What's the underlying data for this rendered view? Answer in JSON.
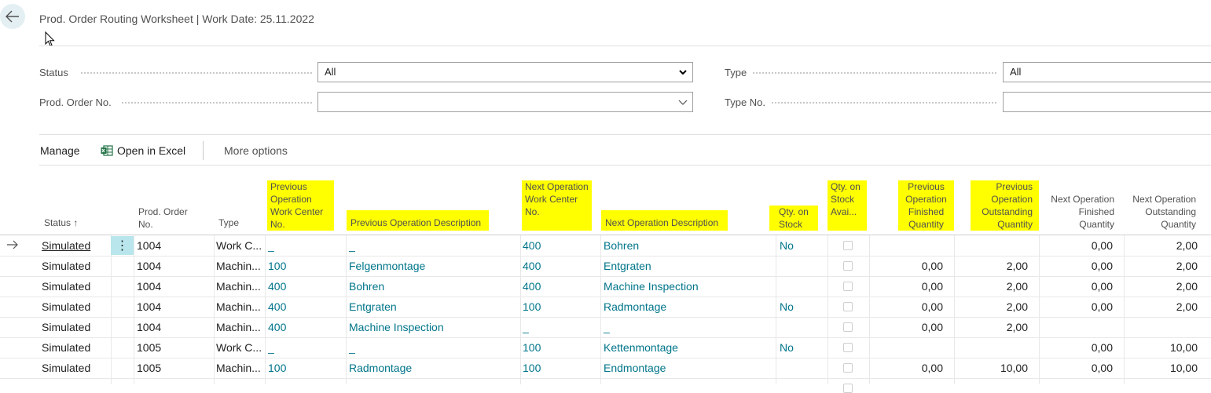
{
  "page": {
    "title": "Prod. Order Routing Worksheet | Work Date: 25.11.2022"
  },
  "filters": {
    "status_label": "Status",
    "status_value": "All",
    "prod_order_label": "Prod. Order No.",
    "prod_order_value": "",
    "type_label": "Type",
    "type_value": "All",
    "type_no_label": "Type No.",
    "type_no_value": ""
  },
  "actions": {
    "manage": "Manage",
    "open_in_excel": "Open in Excel",
    "more_options": "More options"
  },
  "columns": {
    "status": "Status ↑",
    "prod_order_no": "Prod. Order No.",
    "type": "Type",
    "prev_wc": "Previous Operation Work Center No.",
    "prev_desc": "Previous Operation Description",
    "next_wc": "Next Operation Work Center No.",
    "next_desc": "Next Operation Description",
    "qty_on_stock": "Qty. on Stock",
    "qty_on_stock_avail": "Qty. on Stock Avai...",
    "prev_finished": "Previous Operation Finished Quantity",
    "prev_outstanding": "Previous Operation Outstanding Quantity",
    "next_finished": "Next Operation Finished Quantity",
    "next_outstanding": "Next Operation Outstanding Quantity"
  },
  "rows": [
    {
      "status": "Simulated",
      "order": "1004",
      "type": "Work C...",
      "prev_wc": "_",
      "prev_desc": "_",
      "next_wc": "400",
      "next_desc": "Bohren",
      "stock": "No",
      "prev_fin": "",
      "prev_out": "",
      "next_fin": "0,00",
      "next_out": "2,00"
    },
    {
      "status": "Simulated",
      "order": "1004",
      "type": "Machin...",
      "prev_wc": "100",
      "prev_desc": "Felgenmontage",
      "next_wc": "400",
      "next_desc": "Entgraten",
      "stock": "",
      "prev_fin": "0,00",
      "prev_out": "2,00",
      "next_fin": "0,00",
      "next_out": "2,00"
    },
    {
      "status": "Simulated",
      "order": "1004",
      "type": "Machin...",
      "prev_wc": "400",
      "prev_desc": "Bohren",
      "next_wc": "400",
      "next_desc": "Machine Inspection",
      "stock": "",
      "prev_fin": "0,00",
      "prev_out": "2,00",
      "next_fin": "0,00",
      "next_out": "2,00"
    },
    {
      "status": "Simulated",
      "order": "1004",
      "type": "Machin...",
      "prev_wc": "400",
      "prev_desc": "Entgraten",
      "next_wc": "100",
      "next_desc": "Radmontage",
      "stock": "No",
      "prev_fin": "0,00",
      "prev_out": "2,00",
      "next_fin": "0,00",
      "next_out": "2,00"
    },
    {
      "status": "Simulated",
      "order": "1004",
      "type": "Machin...",
      "prev_wc": "400",
      "prev_desc": "Machine Inspection",
      "next_wc": "_",
      "next_desc": "_",
      "stock": "",
      "prev_fin": "0,00",
      "prev_out": "2,00",
      "next_fin": "",
      "next_out": ""
    },
    {
      "status": "Simulated",
      "order": "1005",
      "type": "Work C...",
      "prev_wc": "_",
      "prev_desc": "_",
      "next_wc": "100",
      "next_desc": "Kettenmontage",
      "stock": "No",
      "prev_fin": "",
      "prev_out": "",
      "next_fin": "0,00",
      "next_out": "10,00"
    },
    {
      "status": "Simulated",
      "order": "1005",
      "type": "Machin...",
      "prev_wc": "100",
      "prev_desc": "Radmontage",
      "next_wc": "100",
      "next_desc": "Endmontage",
      "stock": "",
      "prev_fin": "0,00",
      "prev_out": "10,00",
      "next_fin": "0,00",
      "next_out": "10,00"
    }
  ],
  "icons": {
    "back": "arrow-left-icon",
    "excel": "excel-icon",
    "row_marker": "arrow-right-icon",
    "row_menu": "vertical-ellipsis-icon"
  },
  "colors": {
    "accent": "#00758a",
    "highlight": "#ffff00",
    "selected_menu": "#b8e6ec"
  }
}
